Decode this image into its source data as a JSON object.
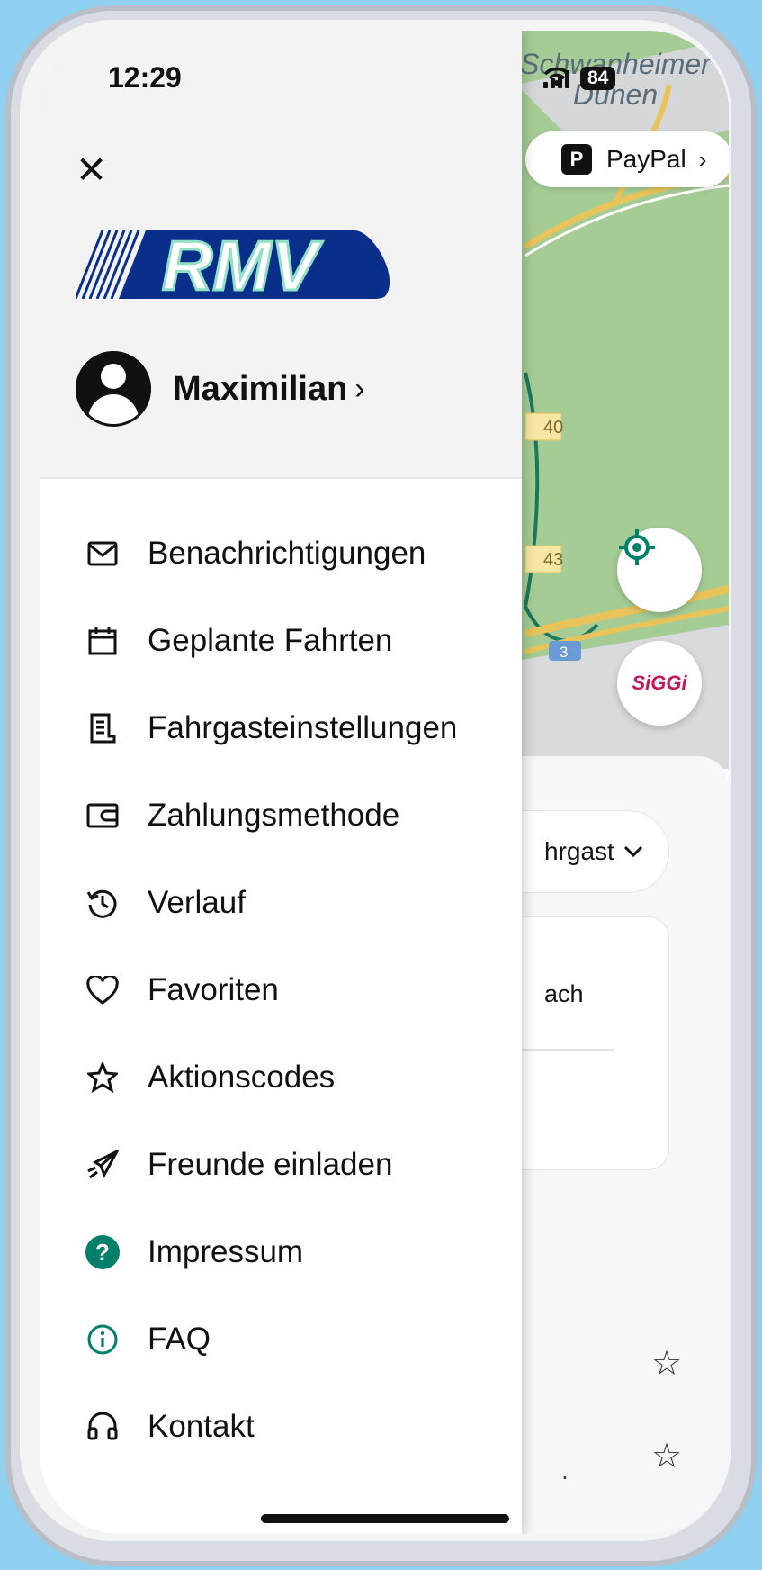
{
  "status_bar": {
    "time": "12:29",
    "battery": "84"
  },
  "map": {
    "place_label_line1": "Schwanheimer",
    "place_label_line2": "Dünen",
    "road_labels": [
      "40",
      "43",
      "3"
    ],
    "payment_pill": {
      "label": "PayPal",
      "icon": "paypal-icon"
    },
    "siggi_label": "SiGGi"
  },
  "sheet": {
    "passenger_text": "hrgast",
    "route_to_text": "ach",
    "dot_text": "."
  },
  "drawer": {
    "close_icon": "close-icon",
    "logo_text": "RMV",
    "user_name": "Maximilian",
    "menu": [
      {
        "label": "Benachrichtigungen",
        "icon": "mail-icon"
      },
      {
        "label": "Geplante Fahrten",
        "icon": "calendar-icon"
      },
      {
        "label": "Fahrgasteinstellungen",
        "icon": "document-icon"
      },
      {
        "label": "Zahlungsmethode",
        "icon": "wallet-icon"
      },
      {
        "label": "Verlauf",
        "icon": "history-icon"
      },
      {
        "label": "Favoriten",
        "icon": "heart-icon"
      },
      {
        "label": "Aktionscodes",
        "icon": "badge-icon"
      },
      {
        "label": "Freunde einladen",
        "icon": "send-icon"
      },
      {
        "label": "Impressum",
        "icon": "help-icon"
      },
      {
        "label": "FAQ",
        "icon": "info-icon"
      },
      {
        "label": "Kontakt",
        "icon": "headset-icon"
      }
    ]
  },
  "colors": {
    "accent": "#00806b",
    "map_green": "#a6cc95",
    "rmv_blue": "#0a2f8a",
    "rmv_mint": "#8fe0c4"
  }
}
